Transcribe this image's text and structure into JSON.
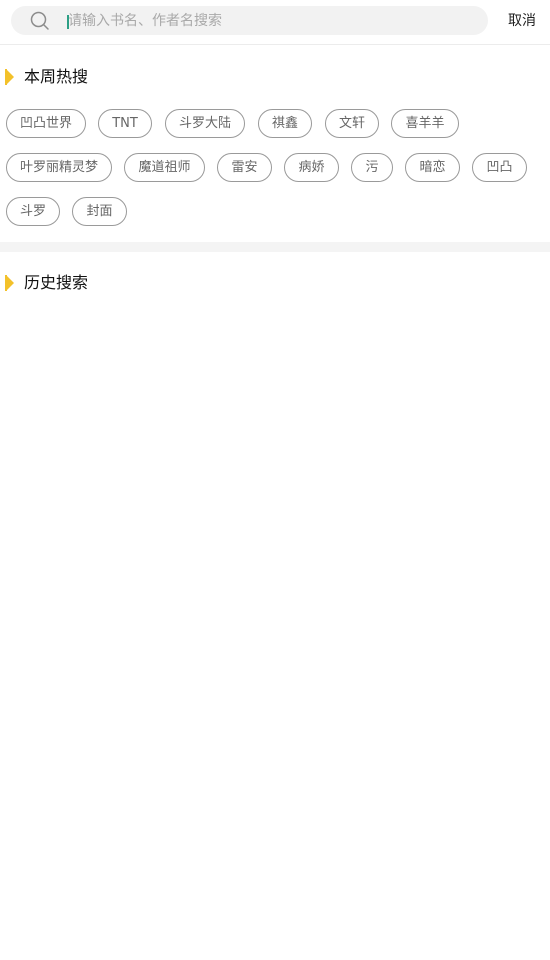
{
  "search": {
    "placeholder": "请输入书名、作者名搜索",
    "value": "",
    "cancel_label": "取消"
  },
  "hot_section": {
    "title": "本周热搜",
    "tags": [
      "凹凸世界",
      "TNT",
      "斗罗大陆",
      "祺鑫",
      "文轩",
      "喜羊羊",
      "叶罗丽精灵梦",
      "魔道祖师",
      "雷安",
      "病娇",
      "污",
      "暗恋",
      "凹凸",
      "斗罗",
      "封面"
    ]
  },
  "history_section": {
    "title": "历史搜索"
  },
  "colors": {
    "accent": "#f3c12a",
    "caret": "#2c9f85",
    "tag_border": "#9a9a9a",
    "search_bg": "#f2f2f2"
  }
}
